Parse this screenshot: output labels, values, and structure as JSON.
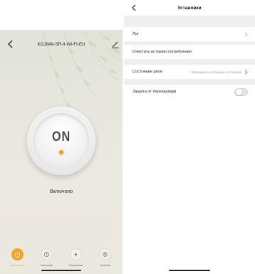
{
  "device_screen": {
    "title": "KOJIMA-SR-II-WI-FI-EU",
    "switch_label": "ON",
    "status": "Включено",
    "tabs": [
      {
        "label": "Выключатель",
        "icon": "power-icon",
        "active": true
      },
      {
        "label": "Расписание",
        "icon": "clock-icon",
        "active": false
      },
      {
        "label": "Потребление",
        "icon": "lightning-icon",
        "active": false
      },
      {
        "label": "Установки",
        "icon": "settings-icon",
        "active": false
      }
    ]
  },
  "settings_screen": {
    "title": "Установки",
    "rows": {
      "log": {
        "label": "Лог"
      },
      "clear_history": {
        "label": "Очистить историю потребления"
      },
      "relay_state": {
        "label": "Состояние реле",
        "value": "Запомнить последнее состояние"
      },
      "overcharge": {
        "label": "Защита от перезарядки",
        "enabled": false
      }
    }
  },
  "colors": {
    "accent": "#f2a524",
    "indicator_dot": "#f39a1f"
  }
}
